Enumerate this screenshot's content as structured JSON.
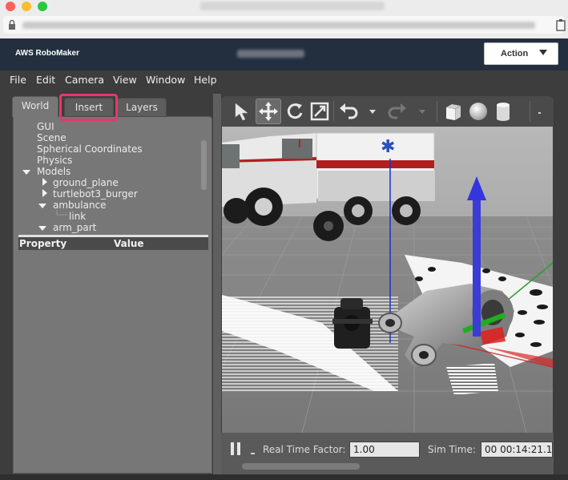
{
  "window": {
    "traffic_lights": {
      "close": "#ff5f57",
      "minimize": "#febc2e",
      "maximize": "#28c840"
    },
    "lock_icon": "lock-icon",
    "clipboard_icon": "clipboard-icon"
  },
  "header": {
    "brand": "AWS RoboMaker",
    "action_label": "Action",
    "background": "#232f3e"
  },
  "menubar": {
    "items": [
      "File",
      "Edit",
      "Camera",
      "View",
      "Window",
      "Help"
    ]
  },
  "left_panel": {
    "tabs": [
      "World",
      "Insert",
      "Layers"
    ],
    "active_tab": "World",
    "highlighted_tab": "Insert",
    "highlight_color": "#e9366d",
    "tree": [
      {
        "label": "GUI",
        "level": 0
      },
      {
        "label": "Scene",
        "level": 0
      },
      {
        "label": "Spherical Coordinates",
        "level": 0
      },
      {
        "label": "Physics",
        "level": 0
      },
      {
        "label": "Models",
        "level": 0,
        "expanded": true
      },
      {
        "label": "ground_plane",
        "level": 1,
        "expanded": false
      },
      {
        "label": "turtlebot3_burger",
        "level": 1,
        "expanded": false
      },
      {
        "label": "ambulance",
        "level": 1,
        "expanded": true
      },
      {
        "label": "link",
        "level": 2
      },
      {
        "label": "arm_part",
        "level": 1,
        "expanded": true
      }
    ],
    "property_header": "Property",
    "value_header": "Value"
  },
  "toolbar": {
    "tools": [
      "select-arrow-icon",
      "translate-icon",
      "rotate-icon",
      "scale-icon",
      "undo-icon",
      "undo-dropdown-icon",
      "redo-icon",
      "redo-dropdown-icon",
      "box-shape-icon",
      "sphere-shape-icon",
      "cylinder-shape-icon",
      "more-icon"
    ],
    "active_tool": "translate-icon"
  },
  "bottombar": {
    "pause_icon": "pause-icon",
    "rtf_label": "Real Time Factor:",
    "rtf_value": "1.00",
    "sim_time_label": "Sim Time:",
    "sim_time_value": "00 00:14:21.1"
  }
}
